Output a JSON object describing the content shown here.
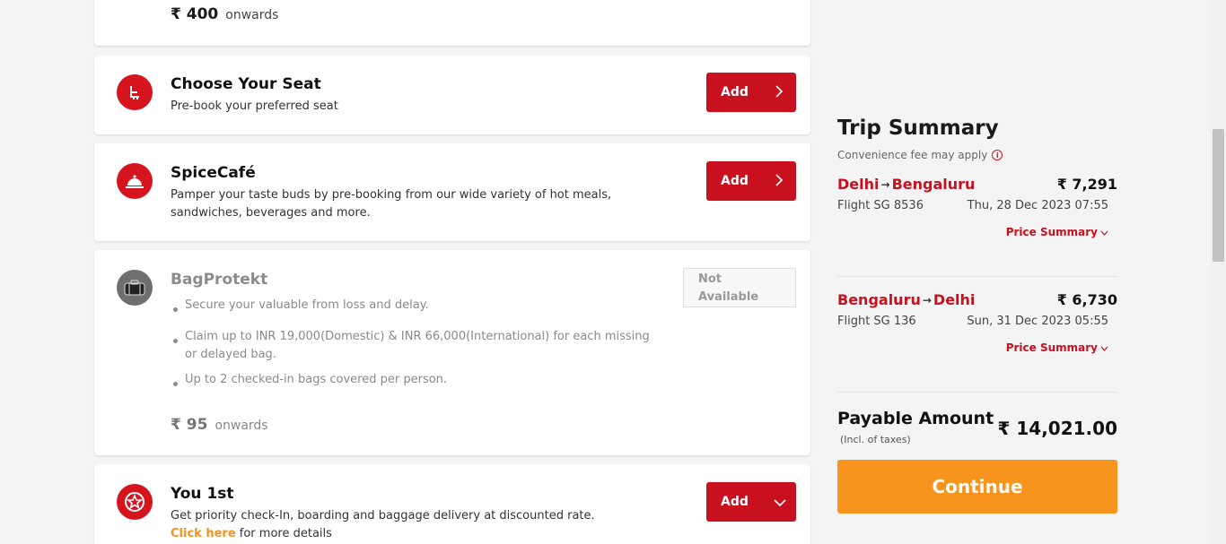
{
  "currency_symbol": "₹",
  "top_card": {
    "amount": "400",
    "suffix": "onwards"
  },
  "seat_card": {
    "title": "Choose Your Seat",
    "desc": "Pre-book your preferred seat",
    "button": "Add"
  },
  "cafe_card": {
    "title": "SpiceCafé",
    "desc_line1": "Pamper your taste buds by pre-booking from our wide variety of hot meals,",
    "desc_line2": "sandwiches, beverages and more.",
    "button": "Add"
  },
  "bag_card": {
    "title": "BagProtekt",
    "status_line1": "Not",
    "status_line2": "Available",
    "bullets": [
      "Secure your valuable from loss and delay.",
      "Claim up to INR 19,000(Domestic) & INR 66,000(International) for each missing or delayed bag.",
      "Up to 2 checked-in bags covered per person."
    ],
    "amount": "95",
    "suffix": "onwards"
  },
  "you1st_card": {
    "title": "You 1st",
    "desc": "Get priority check-In, boarding and baggage delivery at discounted rate.",
    "link": "Click here",
    "link_suffix": "for more details",
    "button": "Add"
  },
  "summary": {
    "title": "Trip Summary",
    "convenience": "Convenience fee may apply",
    "legs": [
      {
        "from": "Delhi",
        "to": "Bengaluru",
        "price": "₹ 7,291",
        "flight": "Flight  SG 8536",
        "date": "Thu, 28 Dec 2023  07:55",
        "price_summary": "Price Summary"
      },
      {
        "from": "Bengaluru",
        "to": "Delhi",
        "price": "₹ 6,730",
        "flight": "Flight  SG 136",
        "date": "Sun, 31 Dec 2023  05:55",
        "price_summary": "Price Summary"
      }
    ],
    "payable_label": "Payable Amount",
    "payable_sub": "(Incl. of taxes)",
    "payable_amount": "₹ 14,021.00",
    "continue": "Continue"
  },
  "colors": {
    "brand_red": "#c8101e",
    "accent_orange": "#f7941d"
  },
  "icons": {
    "seat": "seat-icon",
    "cafe": "cloche-icon",
    "bag": "bag-icon",
    "you1st": "star-badge-icon"
  }
}
